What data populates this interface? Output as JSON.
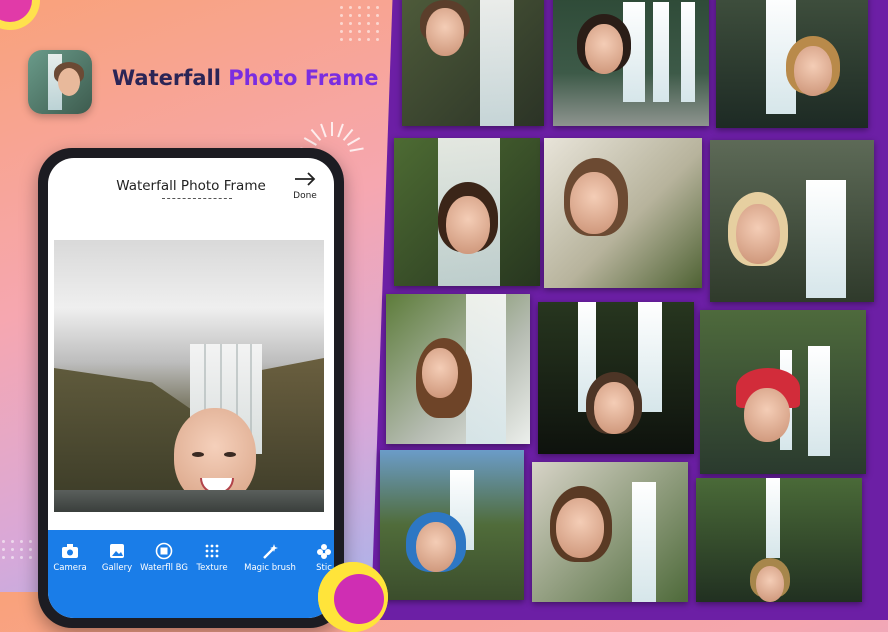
{
  "app": {
    "title_main": "Waterfall ",
    "title_accent": "Photo Frame"
  },
  "phone": {
    "header_title": "Waterfall Photo Frame",
    "done_label": "Done",
    "tools": [
      {
        "label": "Camera",
        "icon": "camera-icon"
      },
      {
        "label": "Gallery",
        "icon": "gallery-icon"
      },
      {
        "label": "Waterfll BG",
        "icon": "background-icon"
      },
      {
        "label": "Texture",
        "icon": "texture-icon"
      },
      {
        "label": "Magic brush",
        "icon": "magic-brush-icon"
      },
      {
        "label": "Stic",
        "icon": "sticker-icon"
      }
    ]
  },
  "colors": {
    "brand_purple": "#6c1fa5",
    "toolbar_blue": "#1a7de8",
    "title_accent": "#7a2de0"
  }
}
